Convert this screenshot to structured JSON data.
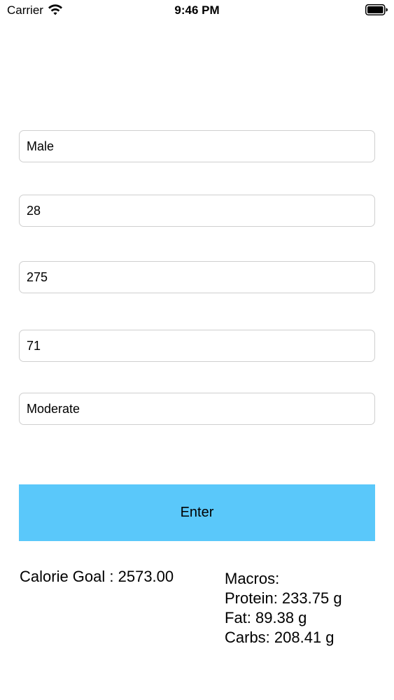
{
  "status_bar": {
    "carrier": "Carrier",
    "time": "9:46 PM"
  },
  "form": {
    "gender": {
      "value": "Male"
    },
    "age": {
      "value": "28"
    },
    "weight": {
      "value": "275"
    },
    "height": {
      "value": "71"
    },
    "activity": {
      "value": "Moderate"
    },
    "enter_label": "Enter"
  },
  "results": {
    "calorie_goal": "Calorie Goal : 2573.00",
    "macros_title": "Macros:",
    "protein": "Protein: 233.75 g",
    "fat": "Fat: 89.38 g",
    "carbs": "Carbs: 208.41 g"
  },
  "colors": {
    "button_bg": "#5ac8fa",
    "field_border": "#cfcfcf"
  },
  "icons": {
    "wifi": "wifi-icon",
    "battery": "battery-icon"
  }
}
